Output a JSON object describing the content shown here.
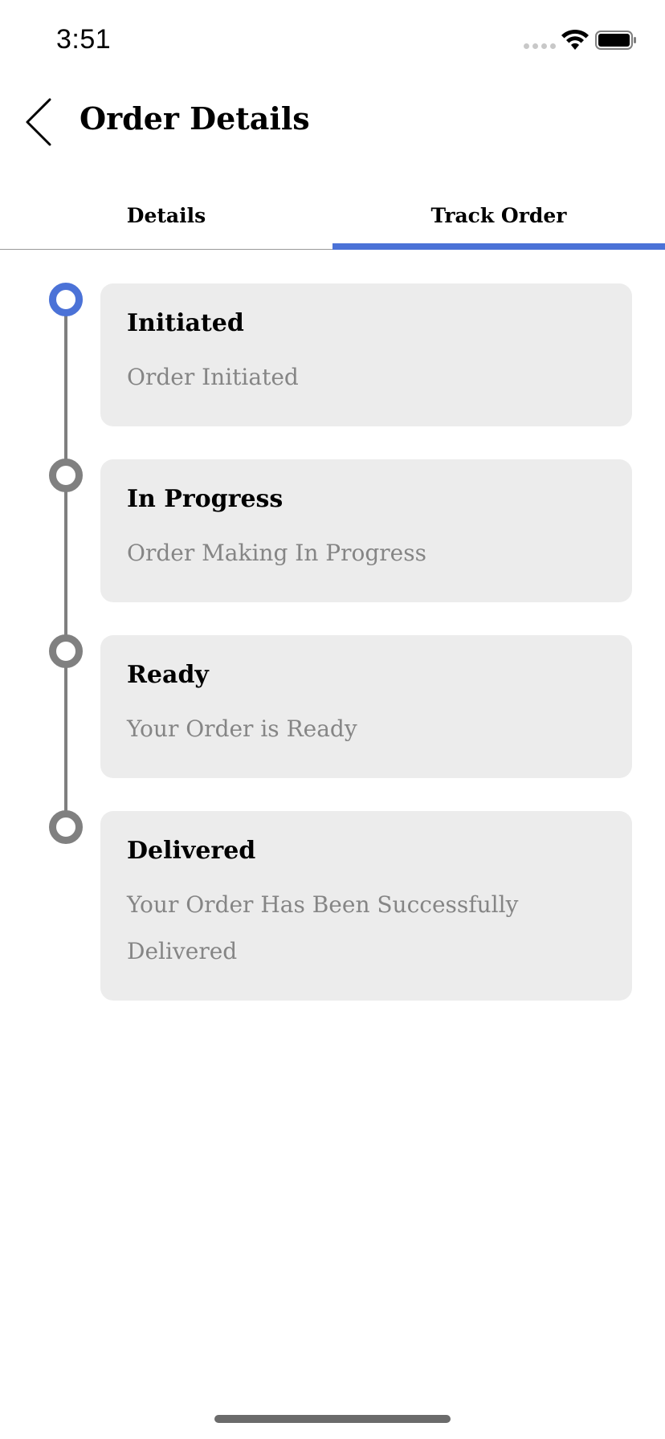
{
  "status_bar": {
    "time": "3:51",
    "icons": [
      "signal-icon",
      "wifi-icon",
      "battery-icon"
    ]
  },
  "header": {
    "back_icon": "chevron-left-icon",
    "title": "Order Details"
  },
  "tabs": [
    {
      "label": "Details",
      "selected": false
    },
    {
      "label": "Track Order",
      "selected": true
    }
  ],
  "colors": {
    "accent": "#4b72d7",
    "card_bg": "#ececec",
    "muted_text": "#858585",
    "timeline_gray": "#808080"
  },
  "steps": [
    {
      "title": "Initiated",
      "description": "Order Initiated",
      "active": true
    },
    {
      "title": "In Progress",
      "description": "Order Making In Progress",
      "active": false
    },
    {
      "title": "Ready",
      "description": "Your Order is Ready",
      "active": false
    },
    {
      "title": "Delivered",
      "description": "Your Order Has Been Successfully Delivered",
      "active": false
    }
  ]
}
